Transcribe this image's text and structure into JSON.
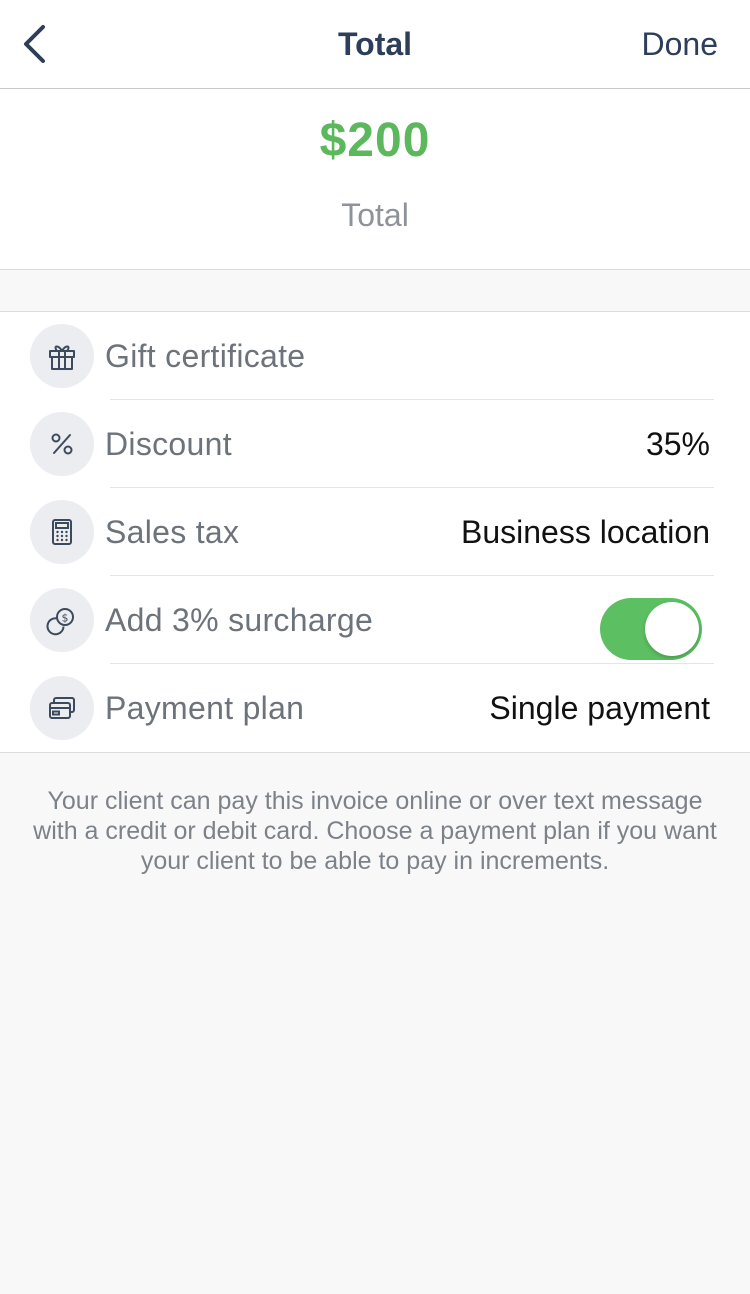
{
  "nav": {
    "back_icon": "chevron-left-icon",
    "title": "Total",
    "done_label": "Done"
  },
  "total": {
    "amount": "$200",
    "label": "Total",
    "amount_color": "#5cb85c"
  },
  "rows": [
    {
      "icon": "gift-icon",
      "label": "Gift certificate",
      "value": ""
    },
    {
      "icon": "percent-icon",
      "label": "Discount",
      "value": "35%"
    },
    {
      "icon": "calculator-icon",
      "label": "Sales tax",
      "value": "Business location"
    },
    {
      "icon": "coins-icon",
      "label": "Add 3% surcharge",
      "toggle_on": true
    },
    {
      "icon": "credit-card-icon",
      "label": "Payment plan",
      "value": "Single payment"
    }
  ],
  "footnote": "Your client can pay this invoice online or over text message with a credit or debit card. Choose a payment plan if you want your client to be able to pay in increments.",
  "colors": {
    "accent_green": "#5cbf62",
    "nav_text": "#2c3e5a"
  }
}
